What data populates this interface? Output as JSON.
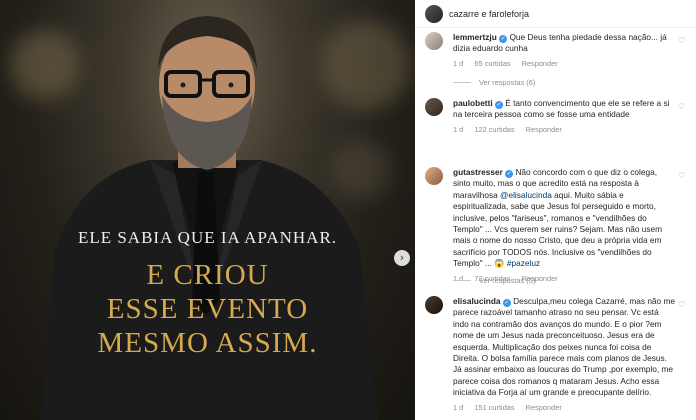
{
  "post": {
    "headline": "Ele sabia que ia apanhar.",
    "subhead_lines": [
      "E criou",
      "esse evento",
      "mesmo assim."
    ],
    "next_icon": "chevron-right-icon"
  },
  "header": {
    "author": "cazarre e faroleforja"
  },
  "comments": [
    {
      "username": "lemmertzju",
      "verified": true,
      "text": "Que Deus tenha piedade dessa nação... já dizia eduardo cunha",
      "time": "1 d",
      "likes": "65 curtidas",
      "reply_label": "Responder",
      "view_replies": "Ver respostas (6)"
    },
    {
      "username": "paulobetti",
      "verified": true,
      "text": "É tanto convencimento que ele se refere a si na terceira pessoa como se fosse uma entidade",
      "time": "1 d",
      "likes": "122 curtidas",
      "reply_label": "Responder",
      "view_replies": ""
    },
    {
      "username": "gutastresser",
      "verified": true,
      "text_before_mention": "Não concordo com o que diz o colega, sinto muito, mas o que acredito está na resposta à maravilhosa",
      "mention": "@elisalucinda",
      "text_after_mention": "aqui. Muito sábia e espiritualizada, sabe que Jesus foi perseguido e morto, inclusive, pelos \"fariseus\", romanos e \"vendilhões do Templo\" ... Vcs querem ser ruins? Sejam. Mas não usem mais o nome do nosso Cristo, que deu a própria vida em sacrifício por TODOS nós. Inclusive os \"vendilhões do Templo\" ... 😱",
      "hashtag": "#pazeluz",
      "time": "1 d",
      "likes": "72 curtidas",
      "reply_label": "Responder",
      "view_replies": "Ver respostas (5)"
    },
    {
      "username": "elisalucinda",
      "verified": true,
      "text": "Desculpa,meu colega Cazarré, mas não me parece razoável tamanho atraso no seu pensar. Vc está indo na contramão dos avanços do mundo. E o pior ?em nome de um Jesus nada preconceituoso. Jesus era de esquerda. Multiplicação dos peixes nunca foi coisa de Direita. O bolsa família parece mais com planos de Jesus. Já assinar embaixo as loucuras do Trump ,por exemplo, me parece coisa dos romanos q mataram Jesus. Acho essa iniciativa da Forja aí um grande e preocupante delírio.",
      "time": "1 d",
      "likes": "151 curtidas",
      "reply_label": "Responder",
      "view_replies": ""
    }
  ],
  "colors": {
    "accent_gold": "#d6a94e",
    "verified_blue": "#3897f0",
    "meta_gray": "#8e8e8e"
  }
}
